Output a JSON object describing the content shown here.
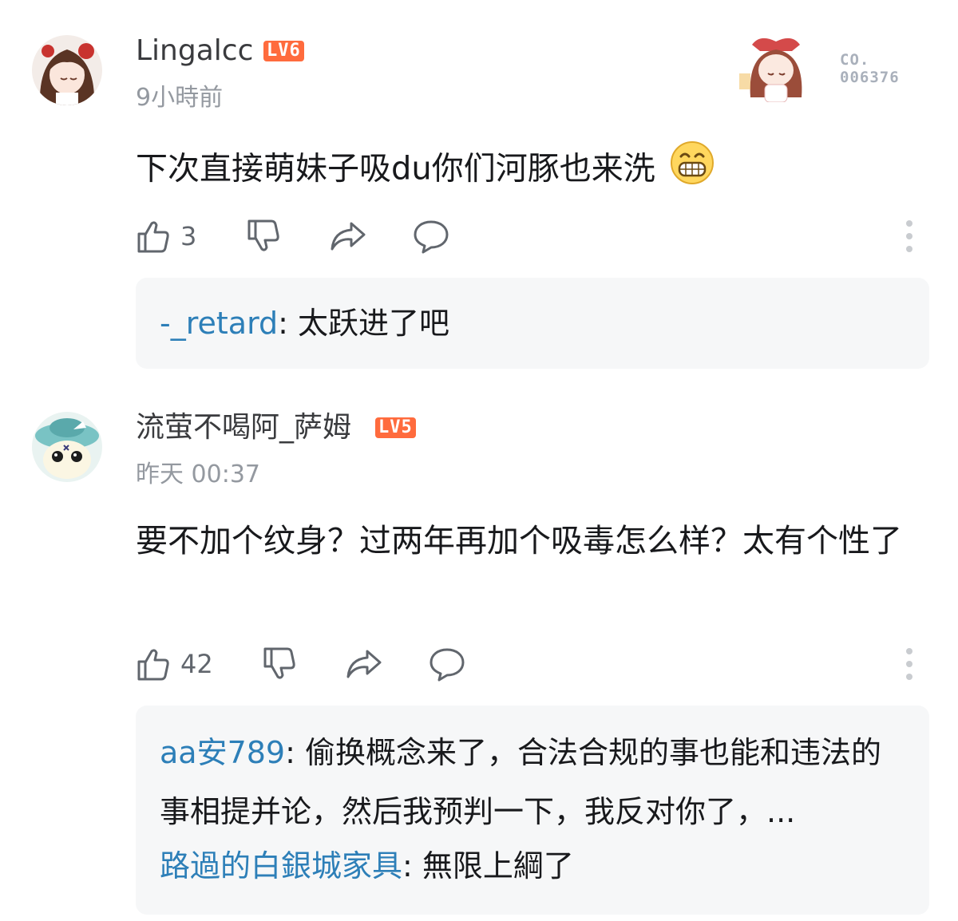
{
  "comments": [
    {
      "username": "Lingalcc",
      "level": "LV6",
      "time": "9小時前",
      "text": "下次直接萌妹子吸du你们河豚也来洗",
      "emoji": "grin-emoji",
      "likes": "3",
      "card": {
        "label": "CO.",
        "number": "006376"
      },
      "replies": [
        {
          "name": "-_retard",
          "text": ": 太跃进了吧"
        }
      ]
    },
    {
      "username": "流萤不喝阿_萨姆",
      "level": "LV5",
      "time": "昨天 00:37",
      "text": "要不加个纹身？过两年再加个吸毒怎么样？太有个性了",
      "likes": "42",
      "replies": [
        {
          "name": "aa安789",
          "text": ": 偷换概念来了，合法合规的事也能和违法的事相提并论，然后我预判一下，我反对你了，..."
        },
        {
          "name": "路過的白銀城家具",
          "text": ": 無限上綱了"
        }
      ]
    }
  ],
  "icons": {
    "like": "thumbs-up-icon",
    "dislike": "thumbs-down-icon",
    "share": "share-icon",
    "reply": "comment-icon",
    "more": "more-vertical-icon"
  },
  "colors": {
    "level_badge": "#ff6b3d",
    "reply_name": "#2d7fb8",
    "reply_bg": "#f6f7f8",
    "secondary_text": "#9499a0"
  }
}
